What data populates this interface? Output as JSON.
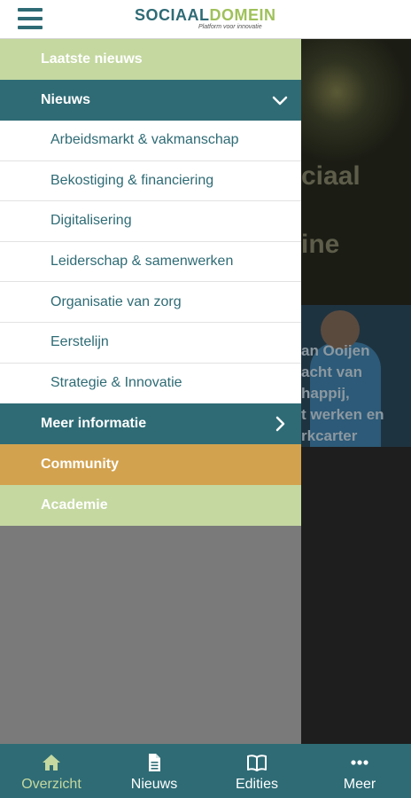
{
  "header": {
    "logo_part1": "SOCIAAL",
    "logo_part2": "DOMEIN",
    "logo_tagline": "Platform voor innovatie"
  },
  "background": {
    "hero_line1": "ciaal",
    "hero_line2": "ine",
    "card_text": [
      "an Ooijen",
      "acht van",
      "happij,",
      "t werken en",
      "rkcarter"
    ]
  },
  "drawer": {
    "latest_news": "Laatste nieuws",
    "news": "Nieuws",
    "news_items": [
      "Arbeidsmarkt & vakmanschap",
      "Bekostiging & financiering",
      "Digitalisering",
      "Leiderschap & samenwerken",
      "Organisatie van zorg",
      "Eerstelijn",
      "Strategie & Innovatie"
    ],
    "more_info": "Meer informatie",
    "community": "Community",
    "academy": "Academie"
  },
  "bottom_nav": {
    "items": [
      {
        "label": "Overzicht",
        "icon": "home-icon",
        "active": true
      },
      {
        "label": "Nieuws",
        "icon": "document-icon",
        "active": false
      },
      {
        "label": "Edities",
        "icon": "book-icon",
        "active": false
      },
      {
        "label": "Meer",
        "icon": "more-icon",
        "active": false
      }
    ]
  },
  "colors": {
    "teal": "#2e6b75",
    "light_green": "#c4d8a0",
    "orange": "#d3a24e",
    "logo_green": "#9fc15a"
  }
}
